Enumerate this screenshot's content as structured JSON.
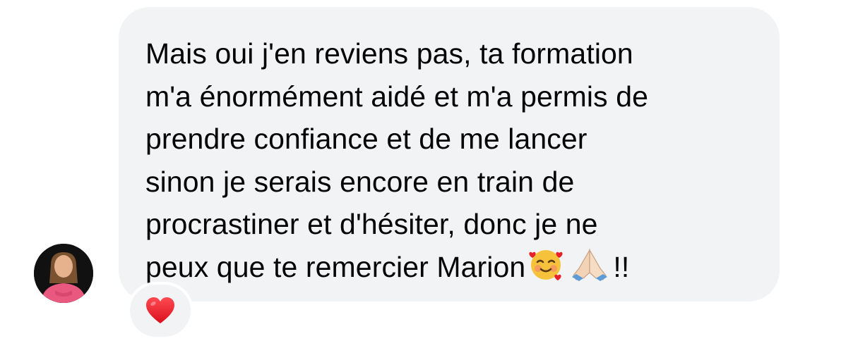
{
  "message": {
    "text": "Mais oui j'en reviens pas, ta formation\nm'a énormément aidé et m'a permis de\nprendre confiance et de me lancer\nsinon je serais encore en train de\nprocrastiner et d'hésiter, donc je ne\npeux que te remercier Marion",
    "emojis": [
      "smiling-face-with-hearts",
      "folded-hands"
    ],
    "suffix": "!!"
  },
  "reaction": {
    "icon": "red-heart"
  },
  "colors": {
    "bubble_background": "#f2f3f5",
    "text": "#050505",
    "heart": "#e8202a",
    "avatar_background": "#111111"
  }
}
